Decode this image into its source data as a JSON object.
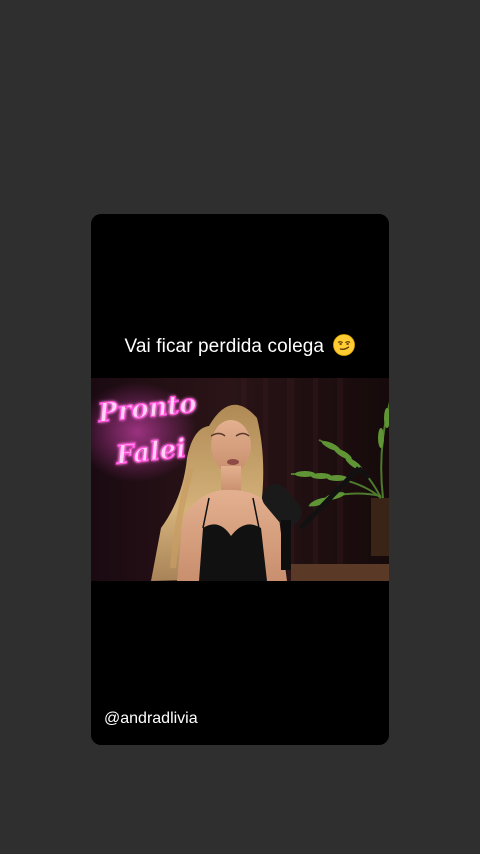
{
  "story": {
    "caption": "Vai ficar perdida colega",
    "caption_emoji": "smirking-face-emoji",
    "username": "@andradlivia"
  },
  "video": {
    "neon_sign_line1": "Pronto",
    "neon_sign_line2": "Falei",
    "neon_color": "#ff4fd8"
  },
  "colors": {
    "background": "#302f2f",
    "card": "#000000",
    "text": "#ffffff"
  }
}
